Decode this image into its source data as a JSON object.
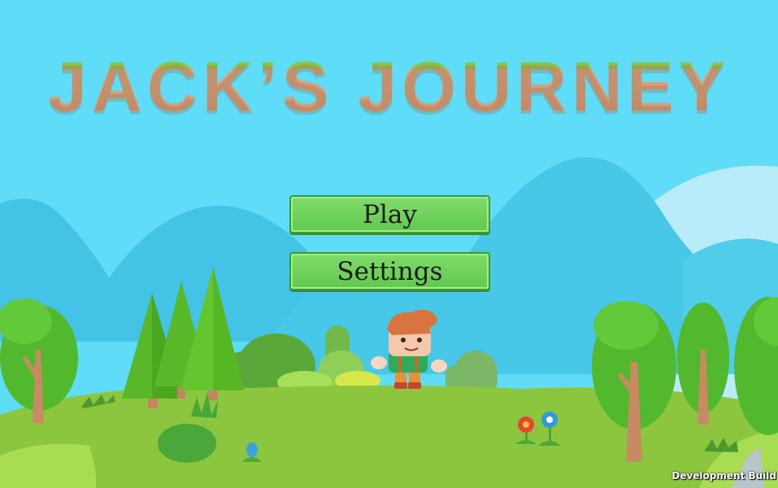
{
  "game": {
    "title": "JACK’S JOURNEY"
  },
  "menu": {
    "play_label": "Play",
    "settings_label": "Settings"
  },
  "footer": {
    "build_label": "Development Build"
  },
  "colors": {
    "sky": "#5fdcf8",
    "button_green": "#6fd45a",
    "button_border": "#3a9a34",
    "grass": "#8cc63f"
  }
}
